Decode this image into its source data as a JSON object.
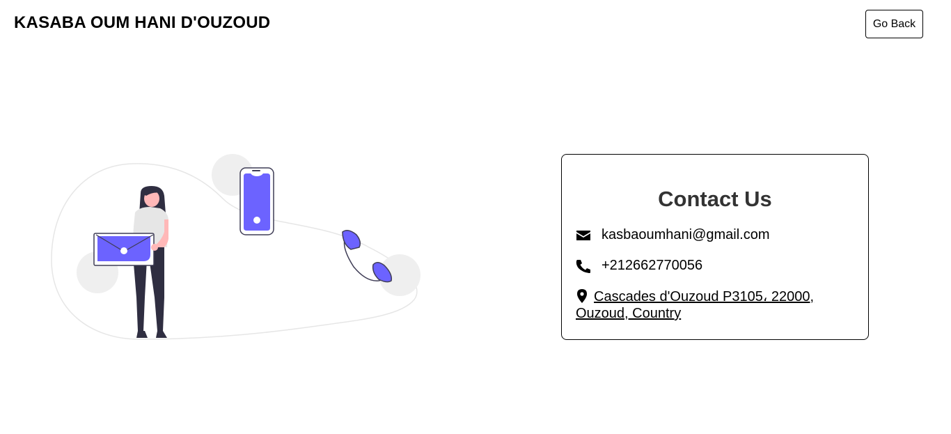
{
  "header": {
    "site_title": "KASABA OUM HANI D'OUZOUD",
    "back_label": "Go Back"
  },
  "contact": {
    "title": "Contact Us",
    "email": "kasbaoumhani@gmail.com",
    "phone": "+212662770056",
    "address": "Cascades d'Ouzoud P3105، 22000, Ouzoud, Country",
    "icons": {
      "email": "envelope-icon",
      "phone": "phone-icon",
      "address": "map-marker-icon"
    }
  },
  "illustration": {
    "accent_color": "#6c63ff",
    "blob_color": "#efefef",
    "figure_dark": "#2f2e41",
    "skin_color": "#ffb8b8"
  }
}
